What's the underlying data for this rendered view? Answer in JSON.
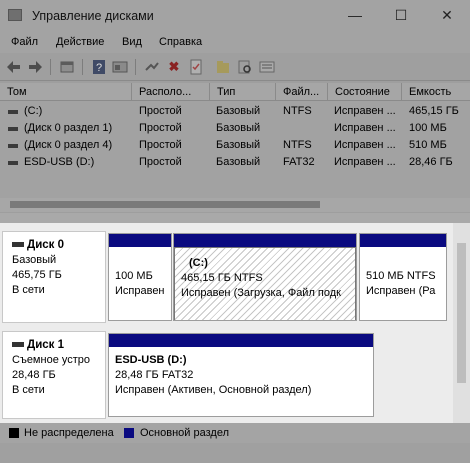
{
  "window": {
    "title": "Управление дисками",
    "minimize": "—",
    "maximize": "☐",
    "close": "✕"
  },
  "menu": [
    "Файл",
    "Действие",
    "Вид",
    "Справка"
  ],
  "toolbar": {
    "back_icon": "arrow-left-icon",
    "forward_icon": "arrow-right-icon",
    "delete_glyph": "✖"
  },
  "table": {
    "columns": [
      "Том",
      "Располо...",
      "Тип",
      "Файл...",
      "Состояние",
      "Емкость"
    ],
    "rows": [
      [
        "(C:)",
        "Простой",
        "Базовый",
        "NTFS",
        "Исправен ...",
        "465,15 ГБ"
      ],
      [
        "(Диск 0 раздел 1)",
        "Простой",
        "Базовый",
        "",
        "Исправен ...",
        "100 МБ"
      ],
      [
        "(Диск 0 раздел 4)",
        "Простой",
        "Базовый",
        "NTFS",
        "Исправен ...",
        "510 МБ"
      ],
      [
        "ESD-USB (D:)",
        "Простой",
        "Базовый",
        "FAT32",
        "Исправен ...",
        "28,46 ГБ"
      ]
    ]
  },
  "disks": [
    {
      "name": "Диск 0",
      "type": "Базовый",
      "size": "465,75 ГБ",
      "status": "В сети",
      "partitions": [
        {
          "title": "",
          "size": "100 МБ",
          "status": "Исправен"
        },
        {
          "title": "(C:)",
          "size": "465,15 ГБ NTFS",
          "status": "Исправен (Загрузка, Файл подк"
        },
        {
          "title": "",
          "size": "510 МБ NTFS",
          "status": "Исправен (Ра"
        }
      ]
    },
    {
      "name": "Диск 1",
      "type": "Съемное устро",
      "size": "28,48 ГБ",
      "status": "В сети",
      "partitions": [
        {
          "title": "ESD-USB  (D:)",
          "size": "28,48 ГБ FAT32",
          "status": "Исправен (Активен, Основной раздел)"
        }
      ]
    }
  ],
  "legend": [
    {
      "label": "Не распределена",
      "color": "#000000"
    },
    {
      "label": "Основной раздел",
      "color": "#0a0a80"
    }
  ]
}
